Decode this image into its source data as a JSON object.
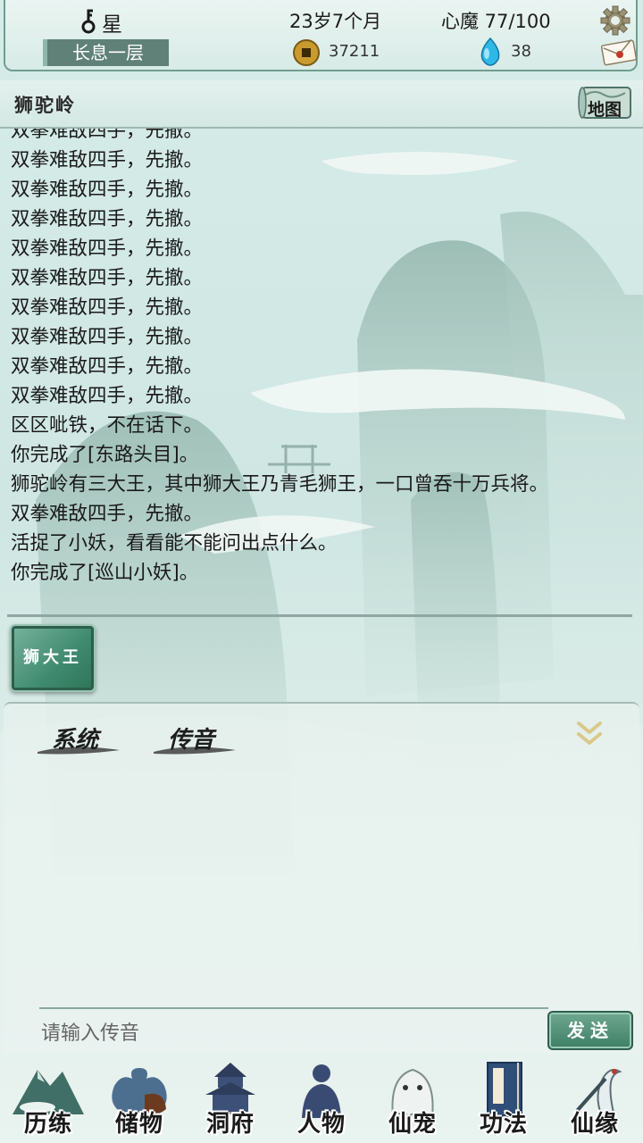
{
  "status": {
    "name": "星",
    "realm": "长息一层",
    "age": "23岁7个月",
    "heart_demon": "心魔 77/100",
    "copper_coins": "37211",
    "spirit_stones": "38"
  },
  "location": {
    "name": "狮驼岭",
    "map_label": "地图"
  },
  "log": [
    "双拳难敌四手，先撤。",
    "双拳难敌四手，先撤。",
    "双拳难敌四手，先撤。",
    "双拳难敌四手，先撤。",
    "双拳难敌四手，先撤。",
    "双拳难敌四手，先撤。",
    "双拳难敌四手，先撤。",
    "双拳难敌四手，先撤。",
    "双拳难敌四手，先撤。",
    "双拳难敌四手，先撤。",
    "区区呲铁，不在话下。",
    "你完成了[东路头目]。",
    "狮驼岭有三大王，其中狮大王乃青毛狮王，一口曾吞十万兵将。",
    "双拳难敌四手，先撤。",
    "活捉了小妖，看看能不能问出点什么。",
    "你完成了[巡山小妖]。"
  ],
  "npc_button": "狮大王",
  "chat": {
    "tabs": [
      "系统",
      "传音"
    ],
    "input_placeholder": "请输入传音",
    "send_label": "发送"
  },
  "nav": {
    "items": [
      {
        "label": "历练",
        "icon": "mountain-icon"
      },
      {
        "label": "储物",
        "icon": "bag-icon"
      },
      {
        "label": "洞府",
        "icon": "pagoda-icon"
      },
      {
        "label": "人物",
        "icon": "person-icon"
      },
      {
        "label": "仙宠",
        "icon": "ghost-pet-icon"
      },
      {
        "label": "功法",
        "icon": "book-icon"
      },
      {
        "label": "仙缘",
        "icon": "crane-icon"
      }
    ]
  },
  "colors": {
    "accent_green": "#3f8a6f",
    "panel_border": "#6f9e8f",
    "realm_bg": "#5f8178",
    "coin_gold": "#c99a2e",
    "gem_blue": "#2fb7e8"
  }
}
